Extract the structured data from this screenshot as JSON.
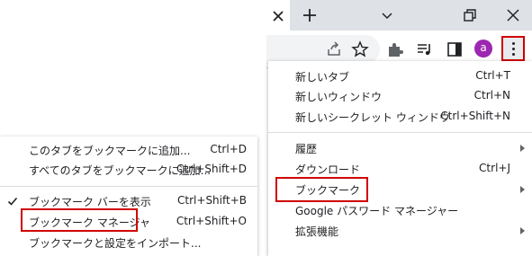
{
  "browser": {
    "avatar_letter": "a",
    "highlight_color": "#d00000"
  },
  "main_menu": {
    "items": [
      {
        "label": "新しいタブ",
        "shortcut": "Ctrl+T"
      },
      {
        "label": "新しいウィンドウ",
        "shortcut": "Ctrl+N"
      },
      {
        "label": "新しいシークレット ウィンドウ",
        "shortcut": "Ctrl+Shift+N"
      },
      {
        "label": "履歴",
        "shortcut": ""
      },
      {
        "label": "ダウンロード",
        "shortcut": "Ctrl+J"
      },
      {
        "label": "ブックマーク",
        "shortcut": ""
      },
      {
        "label": "Google パスワード マネージャー",
        "shortcut": ""
      },
      {
        "label": "拡張機能",
        "shortcut": ""
      }
    ]
  },
  "bookmarks_submenu": {
    "items": [
      {
        "label": "このタブをブックマークに追加...",
        "shortcut": "Ctrl+D"
      },
      {
        "label": "すべてのタブをブックマークに追加...",
        "shortcut": "Ctrl+Shift+D"
      },
      {
        "label": "ブックマーク バーを表示",
        "shortcut": "Ctrl+Shift+B",
        "checked": true
      },
      {
        "label": "ブックマーク マネージャ",
        "shortcut": "Ctrl+Shift+O"
      },
      {
        "label": "ブックマークと設定をインポート...",
        "shortcut": ""
      }
    ]
  }
}
